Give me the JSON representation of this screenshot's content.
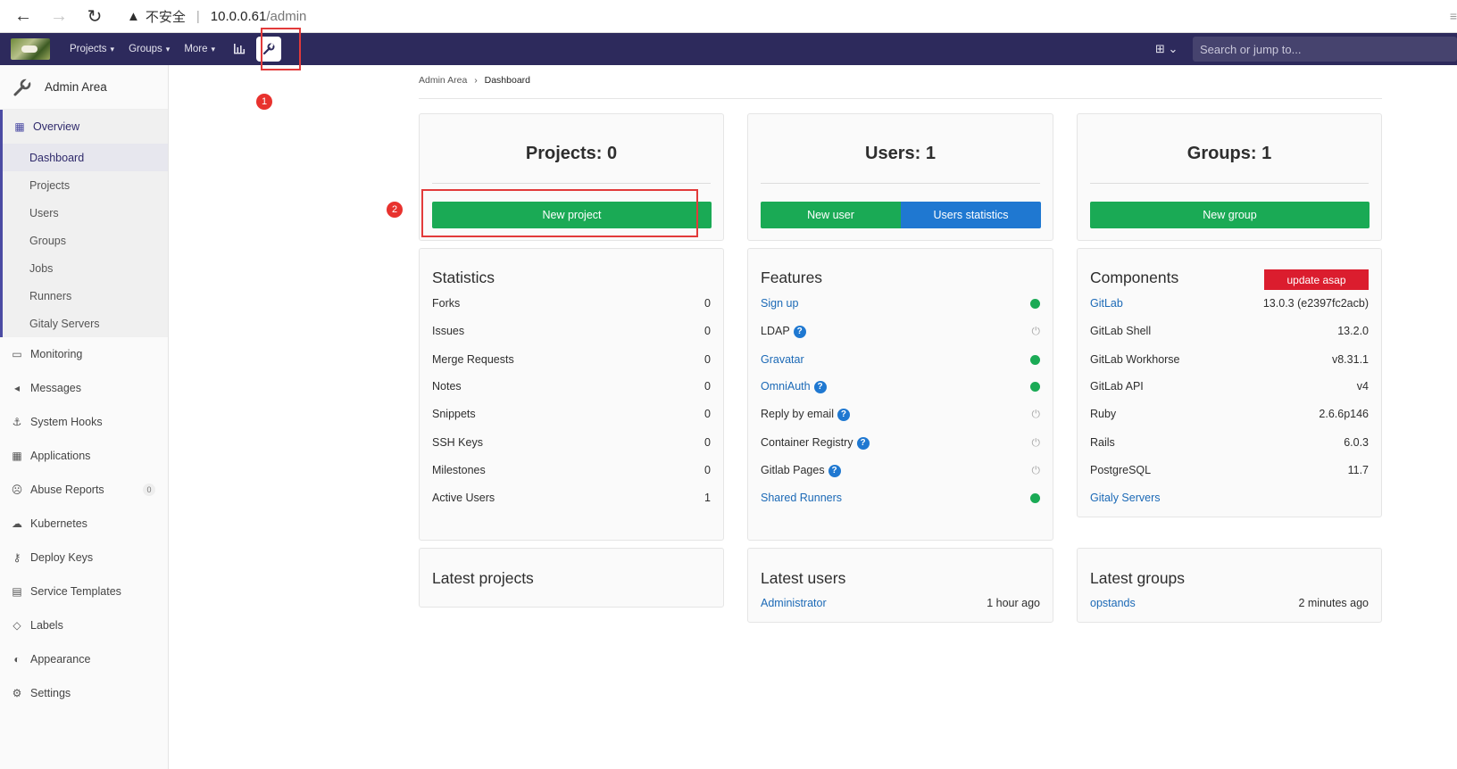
{
  "browser": {
    "warning": "▲",
    "insecure": "不安全",
    "host": "10.0.0.61",
    "path": "/admin",
    "back": "←",
    "forward": "→",
    "reload": "↻"
  },
  "header": {
    "menus": [
      {
        "label": "Projects",
        "chevron": "⌄"
      },
      {
        "label": "Groups",
        "chevron": "⌄"
      },
      {
        "label": "More",
        "chevron": "⌄"
      }
    ],
    "search_placeholder": "Search or jump to...",
    "plus_menu": "⊞ ⌄"
  },
  "annotations": {
    "one": "1",
    "two": "2"
  },
  "sidebar": {
    "title": "Admin Area",
    "overview": "Overview",
    "sub_items": [
      "Dashboard",
      "Projects",
      "Users",
      "Groups",
      "Jobs",
      "Runners",
      "Gitaly Servers"
    ],
    "items": [
      {
        "label": "Monitoring",
        "icon": "monitor-icon"
      },
      {
        "label": "Messages",
        "icon": "megaphone-icon"
      },
      {
        "label": "System Hooks",
        "icon": "hook-icon"
      },
      {
        "label": "Applications",
        "icon": "applications-icon"
      },
      {
        "label": "Abuse Reports",
        "icon": "abuse-icon",
        "badge": "0"
      },
      {
        "label": "Kubernetes",
        "icon": "kubernetes-icon"
      },
      {
        "label": "Deploy Keys",
        "icon": "key-icon"
      },
      {
        "label": "Service Templates",
        "icon": "template-icon"
      },
      {
        "label": "Labels",
        "icon": "label-icon"
      },
      {
        "label": "Appearance",
        "icon": "appearance-icon"
      },
      {
        "label": "Settings",
        "icon": "settings-icon"
      }
    ]
  },
  "breadcrumb": {
    "parent": "Admin Area",
    "separator": "›",
    "current": "Dashboard"
  },
  "counts": {
    "projects": "Projects: 0",
    "users": "Users: 1",
    "groups": "Groups: 1",
    "new_project": "New project",
    "new_user": "New user",
    "users_statistics": "Users statistics",
    "new_group": "New group"
  },
  "statistics": {
    "title": "Statistics",
    "rows": [
      {
        "label": "Forks",
        "value": "0"
      },
      {
        "label": "Issues",
        "value": "0"
      },
      {
        "label": "Merge Requests",
        "value": "0"
      },
      {
        "label": "Notes",
        "value": "0"
      },
      {
        "label": "Snippets",
        "value": "0"
      },
      {
        "label": "SSH Keys",
        "value": "0"
      },
      {
        "label": "Milestones",
        "value": "0"
      },
      {
        "label": "Active Users",
        "value": "1"
      }
    ]
  },
  "features": {
    "title": "Features",
    "rows": [
      {
        "label": "Sign up",
        "link": true,
        "help": false,
        "enabled": true
      },
      {
        "label": "LDAP",
        "link": false,
        "help": true,
        "enabled": false
      },
      {
        "label": "Gravatar",
        "link": true,
        "help": false,
        "enabled": true
      },
      {
        "label": "OmniAuth",
        "link": true,
        "help": true,
        "enabled": true
      },
      {
        "label": "Reply by email",
        "link": false,
        "help": true,
        "enabled": false
      },
      {
        "label": "Container Registry",
        "link": false,
        "help": true,
        "enabled": false
      },
      {
        "label": "Gitlab Pages",
        "link": false,
        "help": true,
        "enabled": false
      },
      {
        "label": "Shared Runners",
        "link": true,
        "help": false,
        "enabled": true
      }
    ]
  },
  "components": {
    "title": "Components",
    "update_badge": "update asap",
    "rows": [
      {
        "label": "GitLab",
        "value": "13.0.3 (e2397fc2acb)",
        "link": true
      },
      {
        "label": "GitLab Shell",
        "value": "13.2.0",
        "link": false
      },
      {
        "label": "GitLab Workhorse",
        "value": "v8.31.1",
        "link": false
      },
      {
        "label": "GitLab API",
        "value": "v4",
        "link": false
      },
      {
        "label": "Ruby",
        "value": "2.6.6p146",
        "link": false
      },
      {
        "label": "Rails",
        "value": "6.0.3",
        "link": false
      },
      {
        "label": "PostgreSQL",
        "value": "11.7",
        "link": false
      },
      {
        "label": "Gitaly Servers",
        "value": "",
        "link": true
      }
    ]
  },
  "latest": {
    "projects_title": "Latest projects",
    "users_title": "Latest users",
    "groups_title": "Latest groups",
    "user_name": "Administrator",
    "user_time": "1 hour ago",
    "group_name": "opstands",
    "group_time": "2 minutes ago"
  },
  "colors": {
    "header": "#2d2a5c",
    "green": "#1aaa55",
    "blue": "#1f78d1",
    "red": "#db1d2e",
    "link": "#1b69b6"
  }
}
